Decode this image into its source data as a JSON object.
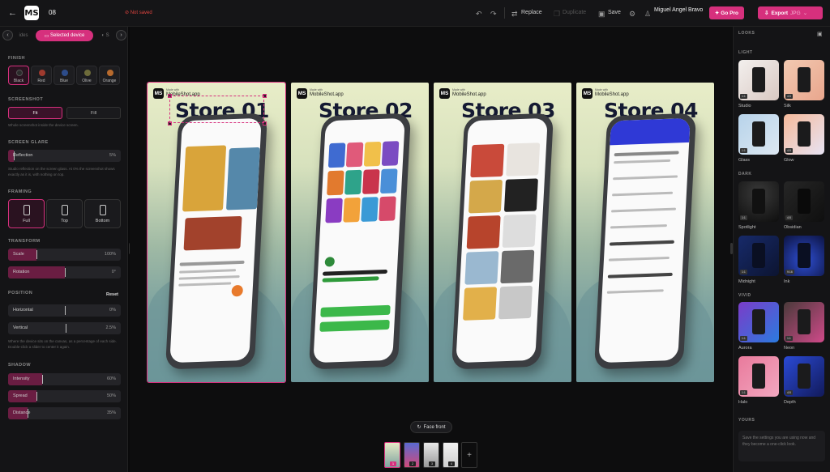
{
  "topbar": {
    "project_name": "08",
    "save_status": "Not saved",
    "replace_label": "Replace",
    "duplicate_label": "Duplicate",
    "save_label": "Save",
    "user_name": "Miguel Angel Bravo",
    "gopro_label": "Go Pro",
    "export_label": "Export",
    "export_format": "JPG"
  },
  "logo_text": "MS",
  "left": {
    "tab_prev_label": "ides",
    "tab_active_label": "Selected device",
    "tab_next_label": "S",
    "finish": {
      "heading": "FINISH",
      "options": [
        {
          "label": "Black",
          "color": "#2b2b2b"
        },
        {
          "label": "Red",
          "color": "#9e3a2e"
        },
        {
          "label": "Blue",
          "color": "#2d4c8a"
        },
        {
          "label": "Olive",
          "color": "#6d6b3a"
        },
        {
          "label": "Orange",
          "color": "#b76a2d"
        }
      ],
      "selected": "Black"
    },
    "screenshot": {
      "heading": "SCREENSHOT",
      "fit_label": "Fit",
      "fill_label": "Fill",
      "hint": "Whole screenshot inside the device screen."
    },
    "glare": {
      "heading": "SCREEN GLARE",
      "label": "Reflection",
      "value": "5%",
      "level": 0.05,
      "hint": "Studio reflection on the screen glass. At 0% the screenshot shows exactly as it is, with nothing on top."
    },
    "framing": {
      "heading": "FRAMING",
      "options": [
        "Full",
        "Top",
        "Bottom"
      ],
      "selected": "Full"
    },
    "transform": {
      "heading": "TRANSFORM",
      "scale_label": "Scale",
      "scale_value": "100%",
      "scale_level": 0.25,
      "rotation_label": "Rotation",
      "rotation_value": "0°",
      "rotation_level": 0.5
    },
    "position": {
      "heading": "POSITION",
      "reset_label": "Reset",
      "horizontal_label": "Horizontal",
      "horizontal_value": "0%",
      "horizontal_level": 0.5,
      "vertical_label": "Vertical",
      "vertical_value": "2.5%",
      "vertical_level": 0.51,
      "hint": "Where the device sits on the canvas, as a percentage of each side. Double-click a slider to center it again."
    },
    "shadow": {
      "heading": "SHADOW",
      "intensity_label": "Intensity",
      "intensity_value": "60%",
      "intensity_level": 0.3,
      "spread_label": "Spread",
      "spread_value": "50%",
      "spread_level": 0.25,
      "distance_label": "Distance",
      "distance_value": "35%",
      "distance_level": 0.17
    }
  },
  "canvas": {
    "cards": [
      {
        "title": "Store 01",
        "brand_tag": "MobileShot.app",
        "brand_sub": "Made with"
      },
      {
        "title": "Store 02",
        "brand_tag": "MobileShot.app",
        "brand_sub": "Made with"
      },
      {
        "title": "Store 03",
        "brand_tag": "MobileShot.app",
        "brand_sub": "Made with"
      },
      {
        "title": "Store 04",
        "brand_tag": "MobileShot.app",
        "brand_sub": "Made with"
      }
    ],
    "selected_card": 0,
    "face_front_label": "Face front",
    "thumbs": [
      "1",
      "2",
      "3",
      "4"
    ],
    "selected_thumb": "1"
  },
  "right": {
    "looks_heading": "LOOKS",
    "light_heading": "LIGHT",
    "dark_heading": "DARK",
    "vivid_heading": "VIVID",
    "yours_heading": "YOURS",
    "looks": [
      {
        "name": "Studio",
        "ratio": "1:1",
        "bg": "linear-gradient(135deg,#f3f0ee,#d9c8c2)"
      },
      {
        "name": "Silk",
        "ratio": "4:5",
        "bg": "linear-gradient(135deg,#f2c9b1,#e9a68d)"
      },
      {
        "name": "Glass",
        "ratio": "1:1",
        "bg": "linear-gradient(135deg,#b7d3ea,#dde8f2)"
      },
      {
        "name": "Glow",
        "ratio": "4:5",
        "bg": "linear-gradient(135deg,#f5b99a,#e7e3f3)"
      },
      {
        "name": "Spotlight",
        "ratio": "1:1",
        "bg": "radial-gradient(circle at 50% 30%,#3a3a3a,#0e0e0e)"
      },
      {
        "name": "Obsidian",
        "ratio": "4:5",
        "bg": "linear-gradient(135deg,#262626,#0f0f0f)"
      },
      {
        "name": "Midnight",
        "ratio": "1:1",
        "bg": "linear-gradient(135deg,#172a6a,#0c1430)"
      },
      {
        "name": "Ink",
        "ratio": "9:16",
        "bg": "radial-gradient(circle at 50% 60%,#2f4fd4,#0c1340)"
      },
      {
        "name": "Aurora",
        "ratio": "1:1",
        "bg": "linear-gradient(135deg,#7a3cc8,#2b7be0)"
      },
      {
        "name": "Neon",
        "ratio": "1:1",
        "bg": "linear-gradient(135deg,#4a3a3a,#d04a8a)"
      },
      {
        "name": "Halo",
        "ratio": "1:1",
        "bg": "linear-gradient(135deg,#e97a9c,#f2a8c0)"
      },
      {
        "name": "Depth",
        "ratio": "4:5",
        "bg": "linear-gradient(135deg,#2a4ad6,#121a5a)"
      }
    ],
    "yours_hint": "Save the settings you are using now and they become a one-click look."
  }
}
